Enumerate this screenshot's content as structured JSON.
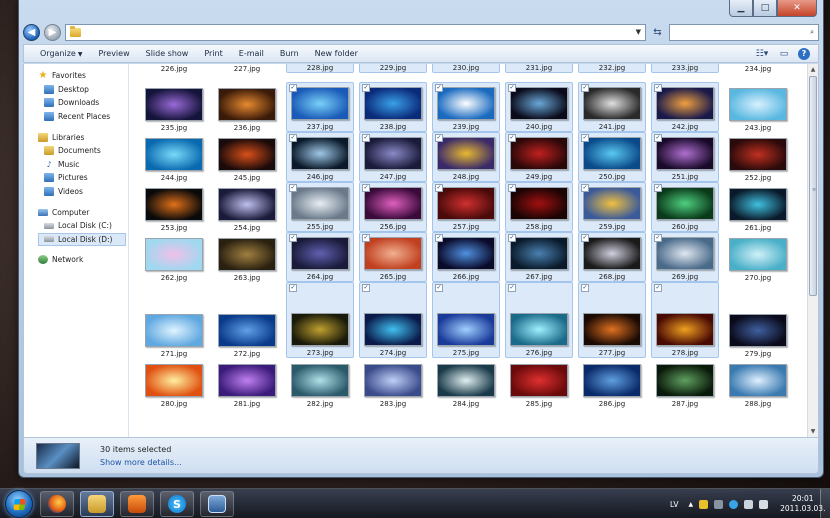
{
  "window": {
    "caption_buttons": {
      "minimize": "▁",
      "maximize": "□",
      "close": "✕"
    }
  },
  "nav_bar": {
    "back_glyph": "◀",
    "forward_glyph": "▶",
    "address_dropdown": "▼",
    "refresh_glyph": "⇆"
  },
  "toolbar": {
    "organize": "Organize",
    "organize_arrow": "▼",
    "preview": "Preview",
    "slideshow": "Slide show",
    "print": "Print",
    "email": "E-mail",
    "burn": "Burn",
    "new_folder": "New folder",
    "help": "?"
  },
  "nav_pane": {
    "favorites": "Favorites",
    "desktop": "Desktop",
    "downloads": "Downloads",
    "recent": "Recent Places",
    "libraries": "Libraries",
    "documents": "Documents",
    "music": "Music",
    "pictures": "Pictures",
    "videos": "Videos",
    "computer": "Computer",
    "disk_c": "Local Disk (C:)",
    "disk_d": "Local Disk (D:)",
    "network": "Network"
  },
  "files": [
    {
      "name": "226.jpg",
      "selected": false,
      "c": [
        "#3a1c4a",
        "#b86aa8"
      ]
    },
    {
      "name": "227.jpg",
      "selected": false,
      "c": [
        "#1a1010",
        "#b55a20"
      ]
    },
    {
      "name": "228.jpg",
      "selected": true,
      "c": [
        "#0a0a0a",
        "#333333"
      ]
    },
    {
      "name": "229.jpg",
      "selected": true,
      "c": [
        "#0d1a2a",
        "#4a5a6a"
      ]
    },
    {
      "name": "230.jpg",
      "selected": true,
      "c": [
        "#202020",
        "#6a6a6a"
      ]
    },
    {
      "name": "231.jpg",
      "selected": true,
      "c": [
        "#101a28",
        "#3a5a7a"
      ]
    },
    {
      "name": "232.jpg",
      "selected": true,
      "c": [
        "#1a1a1a",
        "#5a5a5a"
      ]
    },
    {
      "name": "233.jpg",
      "selected": true,
      "c": [
        "#2a1010",
        "#6a3a3a"
      ]
    },
    {
      "name": "234.jpg",
      "selected": false,
      "c": [
        "#101010",
        "#404040"
      ]
    },
    {
      "name": "235.jpg",
      "selected": false,
      "c": [
        "#14143a",
        "#9a6ad8"
      ]
    },
    {
      "name": "236.jpg",
      "selected": false,
      "c": [
        "#3a1a08",
        "#e88a30"
      ]
    },
    {
      "name": "237.jpg",
      "selected": true,
      "c": [
        "#1a5ab8",
        "#7ad0f8"
      ]
    },
    {
      "name": "238.jpg",
      "selected": true,
      "c": [
        "#0a2a7a",
        "#3aa0e8"
      ]
    },
    {
      "name": "239.jpg",
      "selected": true,
      "c": [
        "#1a6ac0",
        "#ffffff"
      ]
    },
    {
      "name": "240.jpg",
      "selected": true,
      "c": [
        "#0a0a1a",
        "#6aa8d8"
      ]
    },
    {
      "name": "241.jpg",
      "selected": true,
      "c": [
        "#2a2a2a",
        "#e0e0e0"
      ]
    },
    {
      "name": "242.jpg",
      "selected": true,
      "c": [
        "#1a1a4a",
        "#f0a040"
      ]
    },
    {
      "name": "243.jpg",
      "selected": false,
      "c": [
        "#5ab8e0",
        "#d8f0ff"
      ]
    },
    {
      "name": "244.jpg",
      "selected": false,
      "c": [
        "#0a6ab0",
        "#7adaf8"
      ]
    },
    {
      "name": "245.jpg",
      "selected": false,
      "c": [
        "#1a0a0a",
        "#d8501a"
      ]
    },
    {
      "name": "246.jpg",
      "selected": true,
      "c": [
        "#0a1a2a",
        "#a0c8e8"
      ]
    },
    {
      "name": "247.jpg",
      "selected": true,
      "c": [
        "#1a1a3a",
        "#8a8ac8"
      ]
    },
    {
      "name": "248.jpg",
      "selected": true,
      "c": [
        "#3a2a6a",
        "#e8b830"
      ]
    },
    {
      "name": "249.jpg",
      "selected": true,
      "c": [
        "#2a0808",
        "#c02020"
      ]
    },
    {
      "name": "250.jpg",
      "selected": true,
      "c": [
        "#0a4a8a",
        "#5ac8f0"
      ]
    },
    {
      "name": "251.jpg",
      "selected": true,
      "c": [
        "#1a0a2a",
        "#b070d0"
      ]
    },
    {
      "name": "252.jpg",
      "selected": false,
      "c": [
        "#2a0a0a",
        "#c03020"
      ]
    },
    {
      "name": "253.jpg",
      "selected": false,
      "c": [
        "#0a0a0a",
        "#e0701a"
      ]
    },
    {
      "name": "254.jpg",
      "selected": false,
      "c": [
        "#1a1a3a",
        "#c0c0f0"
      ]
    },
    {
      "name": "255.jpg",
      "selected": true,
      "c": [
        "#6a7a8a",
        "#e8eef4"
      ]
    },
    {
      "name": "256.jpg",
      "selected": true,
      "c": [
        "#3a0a3a",
        "#e060c0"
      ]
    },
    {
      "name": "257.jpg",
      "selected": true,
      "c": [
        "#4a0a0a",
        "#d03030"
      ]
    },
    {
      "name": "258.jpg",
      "selected": true,
      "c": [
        "#1a0404",
        "#a01010"
      ]
    },
    {
      "name": "259.jpg",
      "selected": true,
      "c": [
        "#3a5a9a",
        "#f0c040"
      ]
    },
    {
      "name": "260.jpg",
      "selected": true,
      "c": [
        "#0a3a1a",
        "#50d080"
      ]
    },
    {
      "name": "261.jpg",
      "selected": false,
      "c": [
        "#0a1a2a",
        "#40c0e0"
      ]
    },
    {
      "name": "262.jpg",
      "selected": false,
      "c": [
        "#a0d8f0",
        "#f0c0e8"
      ]
    },
    {
      "name": "263.jpg",
      "selected": false,
      "c": [
        "#2a2010",
        "#a08040"
      ]
    },
    {
      "name": "264.jpg",
      "selected": true,
      "c": [
        "#1a1a3a",
        "#6060b0"
      ]
    },
    {
      "name": "265.jpg",
      "selected": true,
      "c": [
        "#c04020",
        "#f0b090"
      ]
    },
    {
      "name": "266.jpg",
      "selected": true,
      "c": [
        "#0a0a2a",
        "#5090e0"
      ]
    },
    {
      "name": "267.jpg",
      "selected": true,
      "c": [
        "#0a1a2a",
        "#4a80b0"
      ]
    },
    {
      "name": "268.jpg",
      "selected": true,
      "c": [
        "#1a1a1a",
        "#d0d0e0"
      ]
    },
    {
      "name": "269.jpg",
      "selected": true,
      "c": [
        "#4a6a8a",
        "#e0e8f0"
      ]
    },
    {
      "name": "270.jpg",
      "selected": false,
      "c": [
        "#4ab0c8",
        "#d0f0f8"
      ]
    },
    {
      "name": "271.jpg",
      "selected": false,
      "c": [
        "#60a8e0",
        "#e0f4ff"
      ]
    },
    {
      "name": "272.jpg",
      "selected": false,
      "c": [
        "#0a3a8a",
        "#60a0e8"
      ]
    },
    {
      "name": "273.jpg",
      "selected": true,
      "c": [
        "#1a1a0a",
        "#c0a030"
      ]
    },
    {
      "name": "274.jpg",
      "selected": true,
      "c": [
        "#0a1a4a",
        "#40c0f0"
      ]
    },
    {
      "name": "275.jpg",
      "selected": true,
      "c": [
        "#1a3a9a",
        "#a0d0ff"
      ]
    },
    {
      "name": "276.jpg",
      "selected": true,
      "c": [
        "#1a6a8a",
        "#a0f0ff"
      ]
    },
    {
      "name": "277.jpg",
      "selected": true,
      "c": [
        "#1a0a04",
        "#e07020"
      ]
    },
    {
      "name": "278.jpg",
      "selected": true,
      "c": [
        "#4a0a04",
        "#f0a020"
      ]
    },
    {
      "name": "279.jpg",
      "selected": false,
      "c": [
        "#0a0a1a",
        "#4060a0"
      ]
    },
    {
      "name": "280.jpg",
      "selected": false,
      "c": [
        "#e05010",
        "#fff0a0"
      ]
    },
    {
      "name": "281.jpg",
      "selected": false,
      "c": [
        "#3a1a7a",
        "#c080f0"
      ]
    },
    {
      "name": "282.jpg",
      "selected": false,
      "c": [
        "#2a5a6a",
        "#b0e0e8"
      ]
    },
    {
      "name": "283.jpg",
      "selected": false,
      "c": [
        "#3a4a8a",
        "#c0d0f8"
      ]
    },
    {
      "name": "284.jpg",
      "selected": false,
      "c": [
        "#1a3a4a",
        "#e0f0f0"
      ]
    },
    {
      "name": "285.jpg",
      "selected": false,
      "c": [
        "#6a0a0a",
        "#e03030"
      ]
    },
    {
      "name": "286.jpg",
      "selected": false,
      "c": [
        "#0a2a6a",
        "#60a0e0"
      ]
    },
    {
      "name": "287.jpg",
      "selected": false,
      "c": [
        "#0a1a0a",
        "#60a060"
      ]
    },
    {
      "name": "288.jpg",
      "selected": false,
      "c": [
        "#3a7ab0",
        "#e0f0ff"
      ]
    }
  ],
  "details": {
    "count": "30 items selected",
    "more": "Show more details..."
  },
  "taskbar": {
    "lang": "LV",
    "tray_up": "▲",
    "time": "20:01",
    "date": "2011.03.03.",
    "skype": "S"
  },
  "scrollbar": {
    "up": "▲",
    "down": "▼"
  },
  "checkmark": "✓"
}
